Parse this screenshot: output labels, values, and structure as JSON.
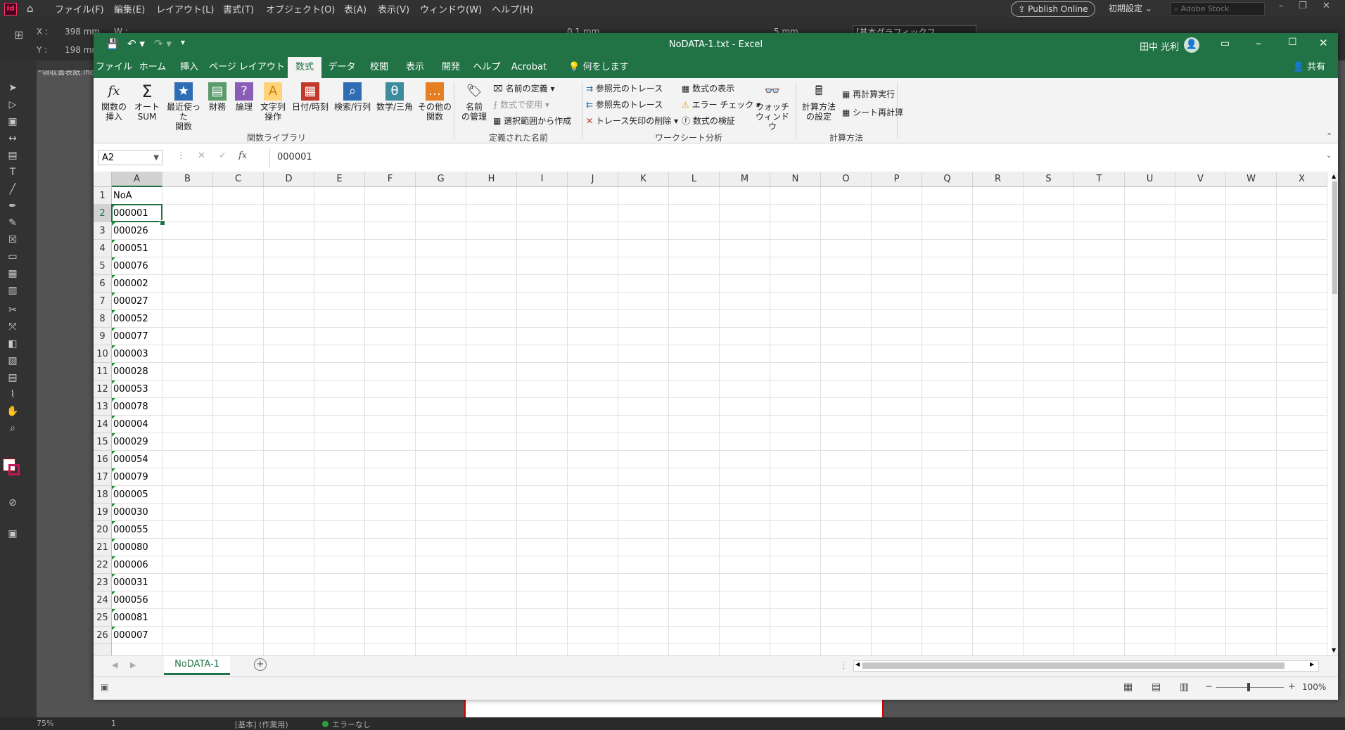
{
  "indesign": {
    "logo": "Id",
    "menus": [
      "ファイル(F)",
      "編集(E)",
      "レイアウト(L)",
      "書式(T)",
      "オブジェクト(O)",
      "表(A)",
      "表示(V)",
      "ウィンドウ(W)",
      "ヘルプ(H)"
    ],
    "publish_label": "Publish Online",
    "workspace": "初期設定",
    "search_placeholder": "Adobe Stock",
    "x_label": "X :",
    "x_value": "398 mm",
    "y_label": "Y :",
    "y_value": "198 mm",
    "w_label": "W :",
    "stroke_value": "0.1 mm",
    "offset_value": "5 mm",
    "style_value": "[基本グラフィックフ",
    "doc_tab": "*領収書表紙.indd",
    "zoom": "75%",
    "page": "1",
    "preset": "[基本] (作業用)",
    "preflight": "エラーなし"
  },
  "excel": {
    "title": "NoDATA-1.txt  -  Excel",
    "user": "田中 光利",
    "share_label": "共有",
    "tabs": [
      {
        "label": "ファイル"
      },
      {
        "label": "ホーム"
      },
      {
        "label": "挿入"
      },
      {
        "label": "ページ レイアウト"
      },
      {
        "label": "数式"
      },
      {
        "label": "データ"
      },
      {
        "label": "校閲"
      },
      {
        "label": "表示"
      },
      {
        "label": "開発"
      },
      {
        "label": "ヘルプ"
      },
      {
        "label": "Acrobat"
      },
      {
        "label": "何をしますか"
      }
    ],
    "ribbon": {
      "insert_fn": "関数の\n挿入",
      "autosum": "オート\nSUM",
      "recent": "最近使った\n関数",
      "finance": "財務",
      "logic": "論理",
      "text": "文字列\n操作",
      "datetime": "日付/時刻",
      "lookup": "検索/行列",
      "math": "数学/三角",
      "other": "その他の\n関数",
      "group_library": "関数ライブラリ",
      "name_mgr": "名前\nの管理",
      "define_name": "名前の定義",
      "use_in_formula": "数式で使用",
      "create_from_sel": "選択範囲から作成",
      "group_names": "定義された名前",
      "trace_prec": "参照元のトレース",
      "trace_dep": "参照先のトレース",
      "remove_arrows": "トレース矢印の削除",
      "show_formulas": "数式の表示",
      "error_check": "エラー チェック",
      "eval_formula": "数式の検証",
      "watch": "ウォッチ\nウィンドウ",
      "group_audit": "ワークシート分析",
      "calc_options": "計算方法\nの設定",
      "calc_now": "再計算実行",
      "calc_sheet": "シート再計算",
      "group_calc": "計算方法"
    },
    "namebox": "A2",
    "formula": "000001",
    "columns": [
      "A",
      "B",
      "C",
      "D",
      "E",
      "F",
      "G",
      "H",
      "I",
      "J",
      "K",
      "L",
      "M",
      "N",
      "O",
      "P",
      "Q",
      "R",
      "S",
      "T",
      "U",
      "V",
      "W",
      "X"
    ],
    "rows": [
      {
        "n": "1",
        "a": "NoA"
      },
      {
        "n": "2",
        "a": "000001"
      },
      {
        "n": "3",
        "a": "000026"
      },
      {
        "n": "4",
        "a": "000051"
      },
      {
        "n": "5",
        "a": "000076"
      },
      {
        "n": "6",
        "a": "000002"
      },
      {
        "n": "7",
        "a": "000027"
      },
      {
        "n": "8",
        "a": "000052"
      },
      {
        "n": "9",
        "a": "000077"
      },
      {
        "n": "10",
        "a": "000003"
      },
      {
        "n": "11",
        "a": "000028"
      },
      {
        "n": "12",
        "a": "000053"
      },
      {
        "n": "13",
        "a": "000078"
      },
      {
        "n": "14",
        "a": "000004"
      },
      {
        "n": "15",
        "a": "000029"
      },
      {
        "n": "16",
        "a": "000054"
      },
      {
        "n": "17",
        "a": "000079"
      },
      {
        "n": "18",
        "a": "000005"
      },
      {
        "n": "19",
        "a": "000030"
      },
      {
        "n": "20",
        "a": "000055"
      },
      {
        "n": "21",
        "a": "000080"
      },
      {
        "n": "22",
        "a": "000006"
      },
      {
        "n": "23",
        "a": "000031"
      },
      {
        "n": "24",
        "a": "000056"
      },
      {
        "n": "25",
        "a": "000081"
      },
      {
        "n": "26",
        "a": "000007"
      }
    ],
    "sheet_tab": "NoDATA-1",
    "zoom": "100%",
    "accent": "#217346"
  }
}
